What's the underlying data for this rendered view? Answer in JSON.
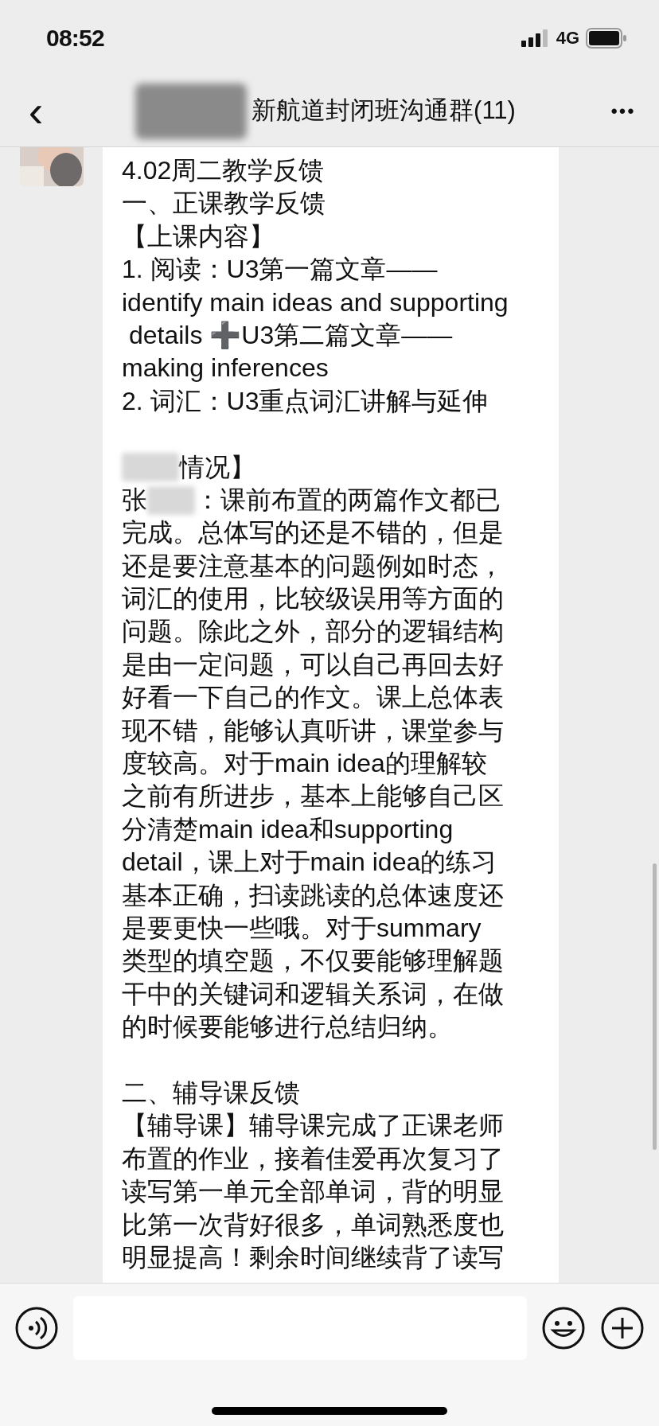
{
  "status_bar": {
    "time": "08:52",
    "network": "4G"
  },
  "header": {
    "back": "‹",
    "title": "新航道封闭班沟通群(11)",
    "more": "•••"
  },
  "message": {
    "lines": [
      {
        "kind": "text",
        "text": "4.02周二教学反馈"
      },
      {
        "kind": "text",
        "text": "一、正课教学反馈"
      },
      {
        "kind": "text",
        "text": "【上课内容】"
      },
      {
        "kind": "text",
        "text": "1. 阅读：U3第一篇文章——"
      },
      {
        "kind": "text",
        "text": "identify main ideas and supporting"
      },
      {
        "kind": "text",
        "text": " details ➕U3第二篇文章——"
      },
      {
        "kind": "text",
        "text": "making inferences"
      },
      {
        "kind": "text",
        "text": "2. 词汇：U3重点词汇讲解与延伸"
      },
      {
        "kind": "blank"
      },
      {
        "kind": "redacted",
        "after": "情况】"
      },
      {
        "kind": "redacted",
        "before": "张",
        "after": "：课前布置的两篇作文都已"
      },
      {
        "kind": "text",
        "text": "完成。总体写的还是不错的，但是"
      },
      {
        "kind": "text",
        "text": "还是要注意基本的问题例如时态，"
      },
      {
        "kind": "text",
        "text": "词汇的使用，比较级误用等方面的"
      },
      {
        "kind": "text",
        "text": "问题。除此之外，部分的逻辑结构"
      },
      {
        "kind": "text",
        "text": "是由一定问题，可以自己再回去好"
      },
      {
        "kind": "text",
        "text": "好看一下自己的作文。课上总体表"
      },
      {
        "kind": "text",
        "text": "现不错，能够认真听讲，课堂参与"
      },
      {
        "kind": "text",
        "text": "度较高。对于main idea的理解较"
      },
      {
        "kind": "text",
        "text": "之前有所进步，基本上能够自己区"
      },
      {
        "kind": "text",
        "text": "分清楚main idea和supporting"
      },
      {
        "kind": "text",
        "text": "detail，课上对于main idea的练习"
      },
      {
        "kind": "text",
        "text": "基本正确，扫读跳读的总体速度还"
      },
      {
        "kind": "text",
        "text": "是要更快一些哦。对于summary"
      },
      {
        "kind": "text",
        "text": "类型的填空题，不仅要能够理解题"
      },
      {
        "kind": "text",
        "text": "干中的关键词和逻辑关系词，在做"
      },
      {
        "kind": "text",
        "text": "的时候要能够进行总结归纳。"
      },
      {
        "kind": "blank"
      },
      {
        "kind": "text",
        "text": "二、辅导课反馈"
      },
      {
        "kind": "text",
        "text": "【辅导课】辅导课完成了正课老师"
      },
      {
        "kind": "text",
        "text": "布置的作业，接着佳爱再次复习了"
      },
      {
        "kind": "text",
        "text": "读写第一单元全部单词，背的明显"
      },
      {
        "kind": "text",
        "text": "比第一次背好很多，单词熟悉度也"
      },
      {
        "kind": "text",
        "text": "明显提高！剩余时间继续背了读写"
      }
    ]
  }
}
